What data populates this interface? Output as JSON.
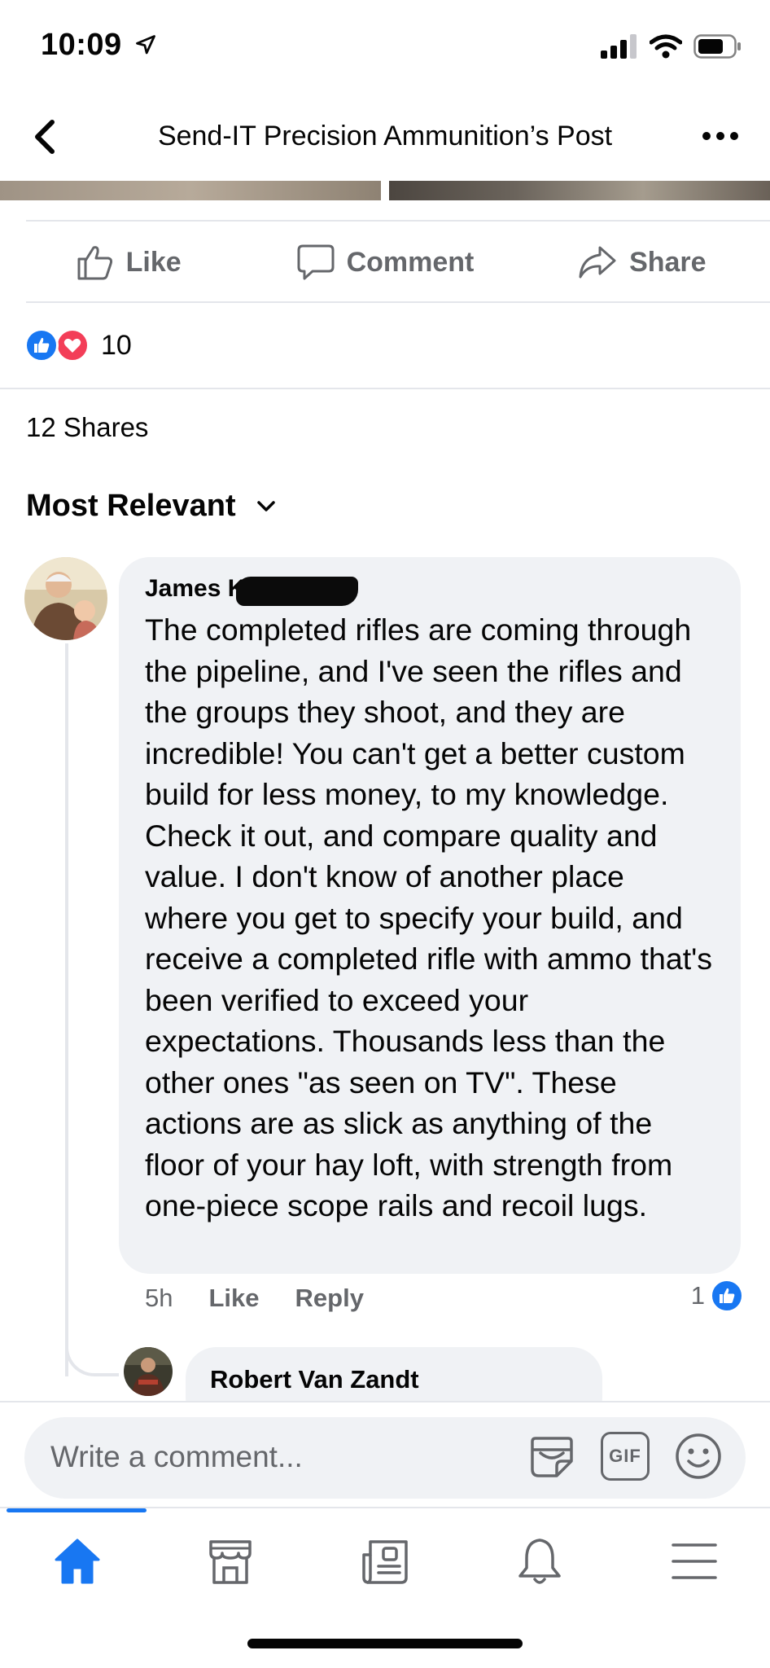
{
  "status_bar": {
    "time": "10:09",
    "icons": [
      "location-arrow-icon",
      "cellular-signal-icon",
      "wifi-icon",
      "battery-icon"
    ]
  },
  "nav": {
    "title": "Send-IT Precision Ammunition’s Post",
    "back_icon": "chevron-left-icon",
    "more_icon": "more-horizontal-icon"
  },
  "actions": {
    "like": "Like",
    "comment": "Comment",
    "share": "Share"
  },
  "reactions": {
    "types": [
      "like",
      "love"
    ],
    "count": "10"
  },
  "shares": "12 Shares",
  "sort": {
    "label": "Most Relevant",
    "icon": "chevron-down-icon"
  },
  "comment": {
    "author": "James K",
    "author_redacted": true,
    "text": "The completed rifles are coming through the pipeline, and I've seen the rifles and the groups they shoot, and they are incredible! You can't get a better custom build for less money, to my knowledge. Check it out, and compare quality and value. I don't know of another place where you get to specify your build, and receive a completed rifle with ammo that's been verified to exceed your expectations. Thousands less than the other ones \"as seen on TV\". These actions are as slick as anything of the floor of your hay loft, with strength from one-piece scope rails and recoil lugs.",
    "time": "5h",
    "like_label": "Like",
    "reply_label": "Reply",
    "like_count": "1"
  },
  "reply": {
    "author": "Robert Van Zandt"
  },
  "composer": {
    "placeholder": "Write a comment...",
    "icons": [
      "sticker-icon",
      "gif-icon",
      "emoji-icon"
    ],
    "gif_label": "GIF"
  },
  "tabbar": {
    "tabs": [
      "home-icon",
      "marketplace-icon",
      "news-icon",
      "notifications-icon",
      "menu-icon"
    ],
    "active": "home-icon"
  },
  "colors": {
    "accent": "#1877f2",
    "love": "#f33e58",
    "secondary_text": "#65676b",
    "bubble": "#f0f2f5"
  }
}
